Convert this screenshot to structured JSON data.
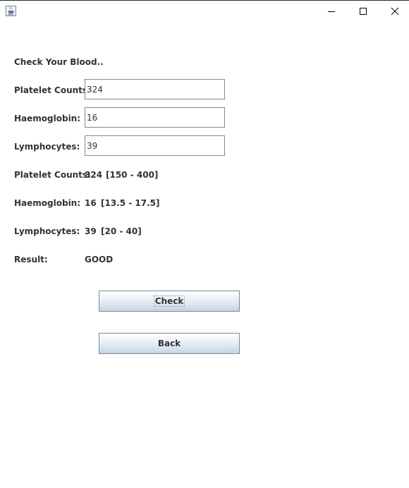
{
  "window": {
    "icon": "java-cup-icon",
    "controls": [
      "minimize-icon",
      "maximize-icon",
      "close-icon"
    ]
  },
  "heading": "Check Your Blood..",
  "form": {
    "platelet": {
      "label": "Platelet Counts",
      "value": "324"
    },
    "haemoglobin": {
      "label": "Haemoglobin:",
      "value": "16"
    },
    "lymphocytes": {
      "label": "Lymphocytes:",
      "value": "39"
    }
  },
  "results": {
    "platelet": {
      "label": "Platelet Counts:",
      "value": "324",
      "range": "[150 - 400]"
    },
    "haemoglobin": {
      "label": "Haemoglobin:",
      "value": "16",
      "range": "[13.5 - 17.5]"
    },
    "lymphocytes": {
      "label": "Lymphocytes:",
      "value": "39",
      "range": "[20 - 40]"
    },
    "result": {
      "label": "Result:",
      "value": "GOOD"
    }
  },
  "buttons": {
    "check": "Check",
    "back": "Back"
  }
}
